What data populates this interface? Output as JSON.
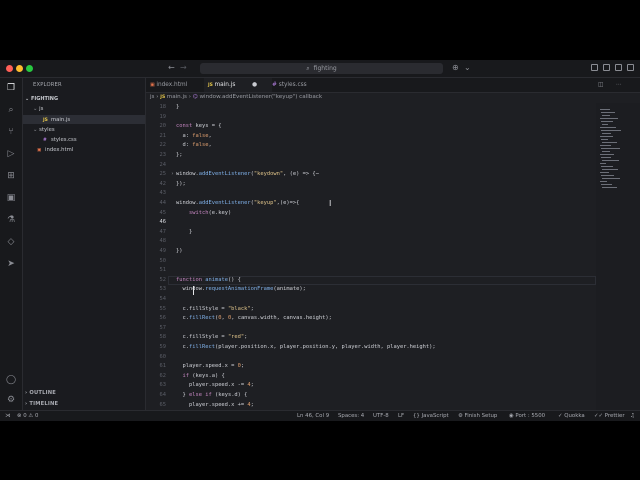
{
  "search": {
    "text": "fighting"
  },
  "sidebar": {
    "explorer_title": "EXPLORER",
    "root_folder": "FIGHTING",
    "tree": [
      {
        "name": "js",
        "kind": "folder"
      },
      {
        "name": "main.js",
        "kind": "js"
      },
      {
        "name": "styles",
        "kind": "folder"
      },
      {
        "name": "styles.css",
        "kind": "css"
      },
      {
        "name": "index.html",
        "kind": "html"
      }
    ],
    "outline": "OUTLINE",
    "timeline": "TIMELINE"
  },
  "tabs": [
    {
      "label": "index.html"
    },
    {
      "label": "main.js"
    },
    {
      "label": "styles.css"
    }
  ],
  "breadcrumb": {
    "folder": "js",
    "file": "main.js",
    "symbol": "window.addEventListener(\"keyup\") callback"
  },
  "editor": {
    "lines": [
      {
        "num": "18",
        "text": "}"
      },
      {
        "num": "19",
        "text": ""
      },
      {
        "num": "20",
        "text": "const keys = {"
      },
      {
        "num": "21",
        "text": "  a: false,"
      },
      {
        "num": "22",
        "text": "  d: false,"
      },
      {
        "num": "23",
        "text": "};"
      },
      {
        "num": "24",
        "text": ""
      },
      {
        "num": "25",
        "text": "window.addEventListener(\"keydown\", (e) => {⋯"
      },
      {
        "num": "42",
        "text": "});"
      },
      {
        "num": "43",
        "text": ""
      },
      {
        "num": "44",
        "text": "window.addEventListener(\"keyup\",(e)=>{"
      },
      {
        "num": "45",
        "text": "    switch(e.key)"
      },
      {
        "num": "46",
        "text": ""
      },
      {
        "num": "47",
        "text": "    }"
      },
      {
        "num": "48",
        "text": ""
      },
      {
        "num": "49",
        "text": "})"
      },
      {
        "num": "50",
        "text": ""
      },
      {
        "num": "51",
        "text": ""
      },
      {
        "num": "52",
        "text": "function animate() {"
      },
      {
        "num": "53",
        "text": "  window.requestAnimationFrame(animate);"
      },
      {
        "num": "54",
        "text": ""
      },
      {
        "num": "55",
        "text": "  c.fillStyle = \"black\";"
      },
      {
        "num": "56",
        "text": "  c.fillRect(0, 0, canvas.width, canvas.height);"
      },
      {
        "num": "57",
        "text": ""
      },
      {
        "num": "58",
        "text": "  c.fillStyle = \"red\";"
      },
      {
        "num": "59",
        "text": "  c.fillRect(player.position.x, player.position.y, player.width, player.height);"
      },
      {
        "num": "60",
        "text": ""
      },
      {
        "num": "61",
        "text": "  player.speed.x = 0;"
      },
      {
        "num": "62",
        "text": "  if (keys.a) {"
      },
      {
        "num": "63",
        "text": "    player.speed.x -= 4;"
      },
      {
        "num": "64",
        "text": "  } else if (keys.d) {"
      },
      {
        "num": "65",
        "text": "    player.speed.x += 4;"
      },
      {
        "num": "66",
        "text": "  }"
      }
    ]
  },
  "status": {
    "errors": "0",
    "warnings": "0",
    "position": "Ln 46, Col 9",
    "spaces": "Spaces: 4",
    "encoding": "UTF-8",
    "eol": "LF",
    "language": "JavaScript",
    "finish_setup": "Finish Setup",
    "port": "Port : 5500",
    "quokka": "Quokka",
    "prettier": "Prettier"
  },
  "colors": {
    "keyword": "#c586c0",
    "function": "#7fb0e8",
    "string": "#e0c48a",
    "number": "#e0a070"
  }
}
